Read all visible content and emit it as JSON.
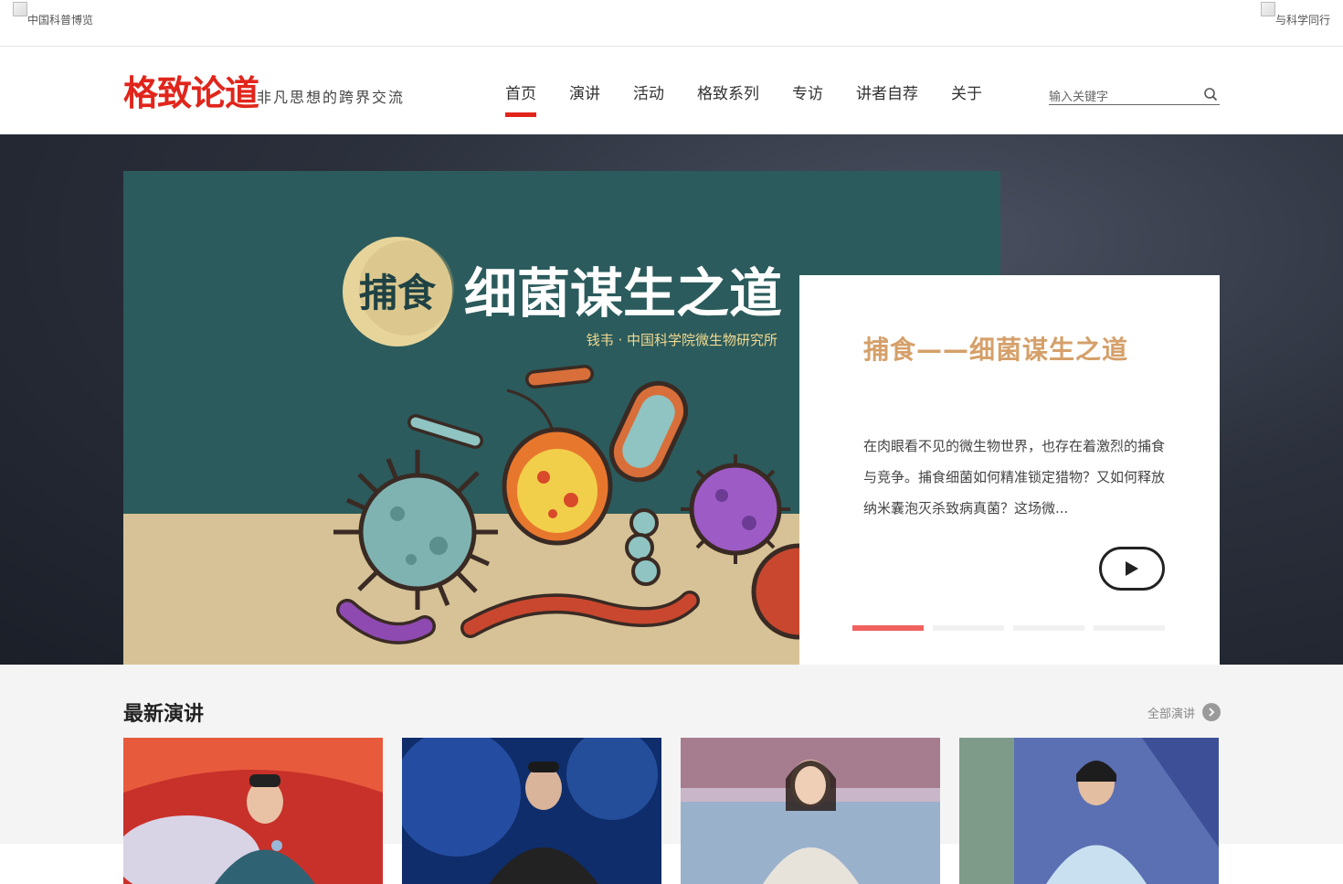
{
  "topbar": {
    "left_alt": "中国科普博览",
    "right_alt": "与科学同行"
  },
  "header": {
    "logo_text": "格致论道",
    "slogan": "非凡思想的跨界交流",
    "nav": [
      {
        "label": "首页",
        "active": true
      },
      {
        "label": "演讲"
      },
      {
        "label": "活动"
      },
      {
        "label": "格致系列"
      },
      {
        "label": "专访"
      },
      {
        "label": "讲者自荐"
      },
      {
        "label": "关于"
      }
    ],
    "search_placeholder": "输入关键字"
  },
  "hero": {
    "banner": {
      "badge": "捕食",
      "title": "细菌谋生之道",
      "speaker": "钱韦 · 中国科学院微生物研究所"
    },
    "card_title": "捕食——细菌谋生之道",
    "card_desc": "在肉眼看不见的微生物世界，也存在着激烈的捕食与竞争。捕食细菌如何精准锁定猎物？又如何释放纳米囊泡灭杀致病真菌？这场微...",
    "active_slide": 1,
    "slide_count": 4
  },
  "latest": {
    "title": "最新演讲",
    "all_link": "全部演讲"
  },
  "colors": {
    "brand_red": "#e1251b",
    "card_title": "#d5a06a",
    "dot_active": "#f0615e"
  }
}
